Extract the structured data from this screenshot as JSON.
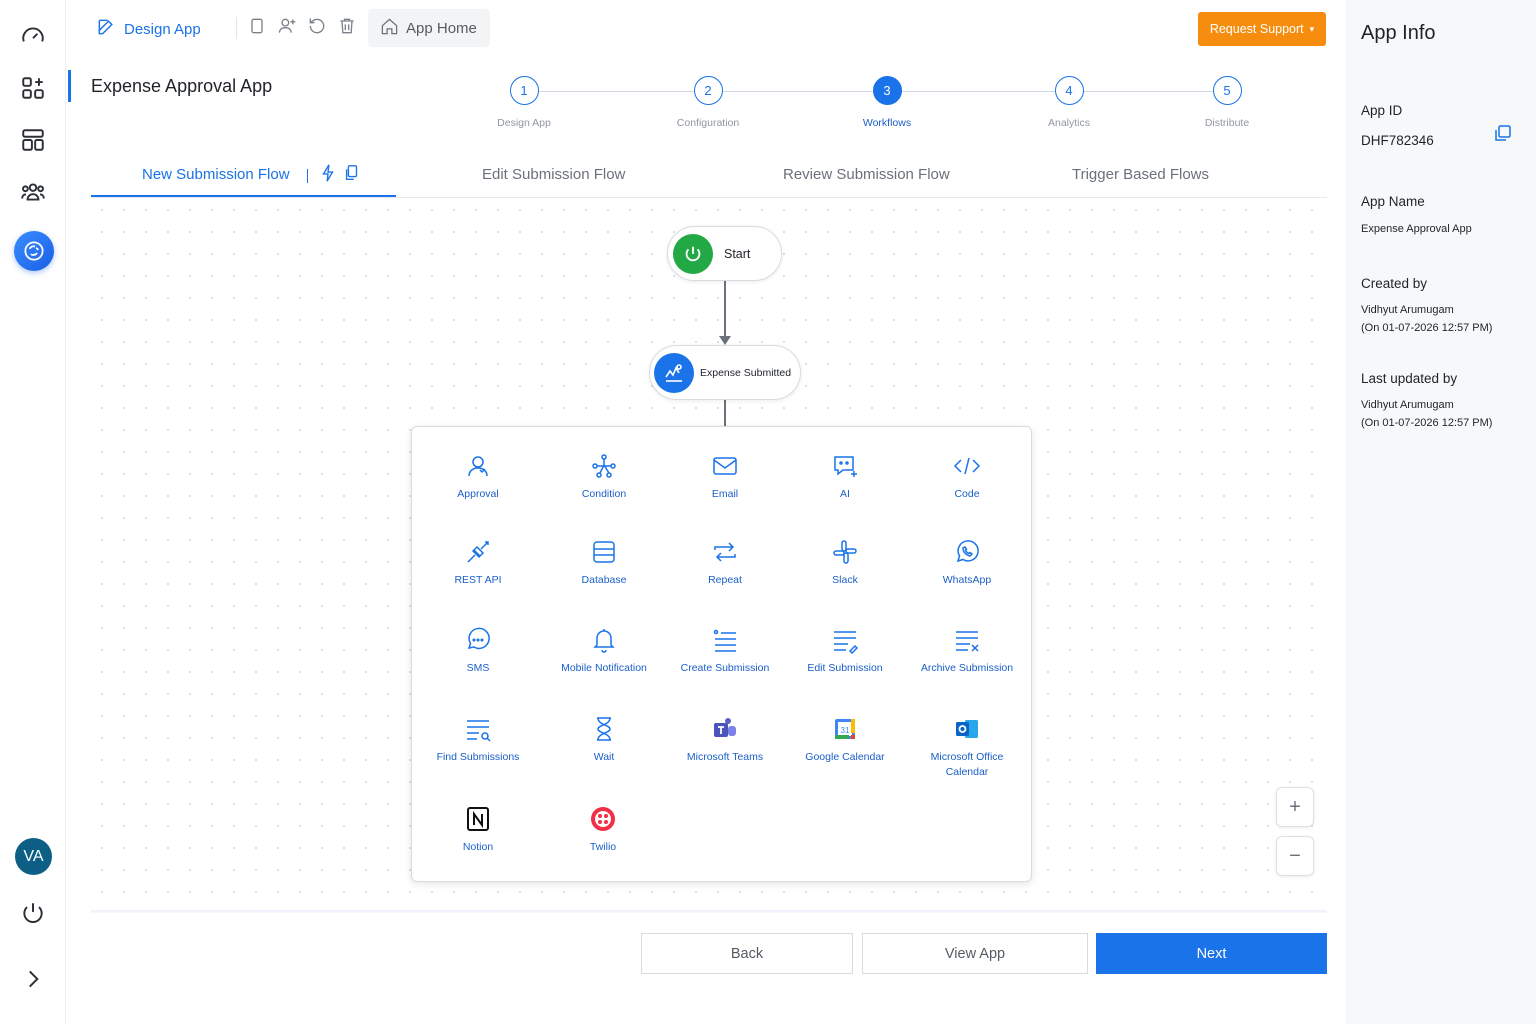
{
  "topbar": {
    "design_app": "Design App",
    "app_home": "App Home",
    "request_support": "Request Support"
  },
  "page_title": "Expense Approval App",
  "stepper": [
    {
      "num": "1",
      "label": "Design App"
    },
    {
      "num": "2",
      "label": "Configuration"
    },
    {
      "num": "3",
      "label": "Workflows"
    },
    {
      "num": "4",
      "label": "Analytics"
    },
    {
      "num": "5",
      "label": "Distribute"
    }
  ],
  "tabs": [
    "New Submission Flow",
    "Edit Submission Flow",
    "Review Submission Flow",
    "Trigger Based Flows"
  ],
  "flow": {
    "start": "Start",
    "trigger": "Expense Submitted"
  },
  "palette": [
    {
      "label": "Approval",
      "icon": "user-icon"
    },
    {
      "label": "Condition",
      "icon": "branch-icon"
    },
    {
      "label": "Email",
      "icon": "mail-icon"
    },
    {
      "label": "AI",
      "icon": "ai-chat-icon"
    },
    {
      "label": "Code",
      "icon": "code-icon"
    },
    {
      "label": "REST API",
      "icon": "api-icon"
    },
    {
      "label": "Database",
      "icon": "database-icon"
    },
    {
      "label": "Repeat",
      "icon": "repeat-icon"
    },
    {
      "label": "Slack",
      "icon": "slack-icon"
    },
    {
      "label": "WhatsApp",
      "icon": "whatsapp-icon"
    },
    {
      "label": "SMS",
      "icon": "sms-icon"
    },
    {
      "label": "Mobile Notification",
      "icon": "bell-icon"
    },
    {
      "label": "Create Submission",
      "icon": "list-add-icon"
    },
    {
      "label": "Edit Submission",
      "icon": "list-edit-icon"
    },
    {
      "label": "Archive Submission",
      "icon": "list-archive-icon"
    },
    {
      "label": "Find Submissions",
      "icon": "list-search-icon"
    },
    {
      "label": "Wait",
      "icon": "hourglass-icon"
    },
    {
      "label": "Microsoft Teams",
      "icon": "teams-icon"
    },
    {
      "label": "Google Calendar",
      "icon": "google-calendar-icon"
    },
    {
      "label": "Microsoft Office Calendar",
      "icon": "outlook-icon"
    },
    {
      "label": "Notion",
      "icon": "notion-icon"
    },
    {
      "label": "Twilio",
      "icon": "twilio-icon"
    }
  ],
  "zoom": {
    "in": "+",
    "out": "−"
  },
  "buttons": {
    "back": "Back",
    "view_app": "View App",
    "next": "Next"
  },
  "rail": {
    "avatar": "VA"
  },
  "app_info": {
    "title": "App Info",
    "app_id_label": "App ID",
    "app_id": "DHF782346",
    "app_name_label": "App Name",
    "app_name": "Expense Approval App",
    "created_by_label": "Created by",
    "created_by": "Vidhyut Arumugam",
    "created_on": "(On 01-07-2026 12:57 PM)",
    "updated_by_label": "Last updated by",
    "updated_by": "Vidhyut Arumugam",
    "updated_on": "(On 01-07-2026 12:57 PM)"
  },
  "colors": {
    "accent": "#1a73e8",
    "support": "#f68d0e",
    "start_green": "#22a845"
  }
}
